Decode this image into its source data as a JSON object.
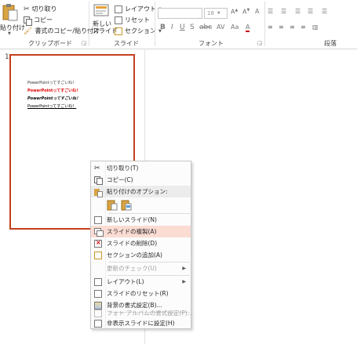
{
  "ribbon": {
    "clipboard": {
      "paste_label": "貼り付け",
      "cut_label": "切り取り",
      "copy_label": "コピー",
      "format_painter_label": "書式のコピー/貼り付け",
      "group_label": "クリップボード"
    },
    "slides": {
      "new_slide_label": "新しい\nスライド",
      "layout_label": "レイアウト",
      "reset_label": "リセット",
      "section_label": "セクション",
      "group_label": "スライド"
    },
    "font": {
      "size_value": "18",
      "group_label": "フォント"
    },
    "paragraph": {
      "group_label": "段落"
    }
  },
  "slide_panel": {
    "slide_number": "1",
    "thumbnail_lines": [
      "PowerPointってすごいね！",
      "PowerPointってすごいね！",
      "PowerPointってすごいね！",
      "PowerPointってすごいね！"
    ]
  },
  "context_menu": {
    "items": [
      {
        "label": "切り取り(T)",
        "icon": "scissors-icon"
      },
      {
        "label": "コピー(C)",
        "icon": "copy-icon"
      },
      {
        "label": "貼り付けのオプション:",
        "icon": "paste-icon"
      },
      {
        "label": "新しいスライド(N)",
        "icon": "new-slide-icon"
      },
      {
        "label": "スライドの複製(A)",
        "icon": "duplicate-slide-icon"
      },
      {
        "label": "スライドの削除(D)",
        "icon": "delete-slide-icon"
      },
      {
        "label": "セクションの追加(A)",
        "icon": "add-section-icon"
      },
      {
        "label": "更新のチェック(U)",
        "icon": ""
      },
      {
        "label": "レイアウト(L)",
        "icon": "layout-icon"
      },
      {
        "label": "スライドのリセット(R)",
        "icon": "reset-slide-icon"
      },
      {
        "label": "背景の書式設定(B)...",
        "icon": "format-background-icon"
      },
      {
        "label": "フォト アルバムの書式設定(P)...",
        "icon": "photo-album-icon"
      },
      {
        "label": "非表示スライドに設定(H)",
        "icon": "hide-slide-icon"
      }
    ]
  },
  "colors": {
    "accent": "#c43e1c",
    "highlight": "#fbdcd3",
    "thumb_red": "#e00000"
  }
}
